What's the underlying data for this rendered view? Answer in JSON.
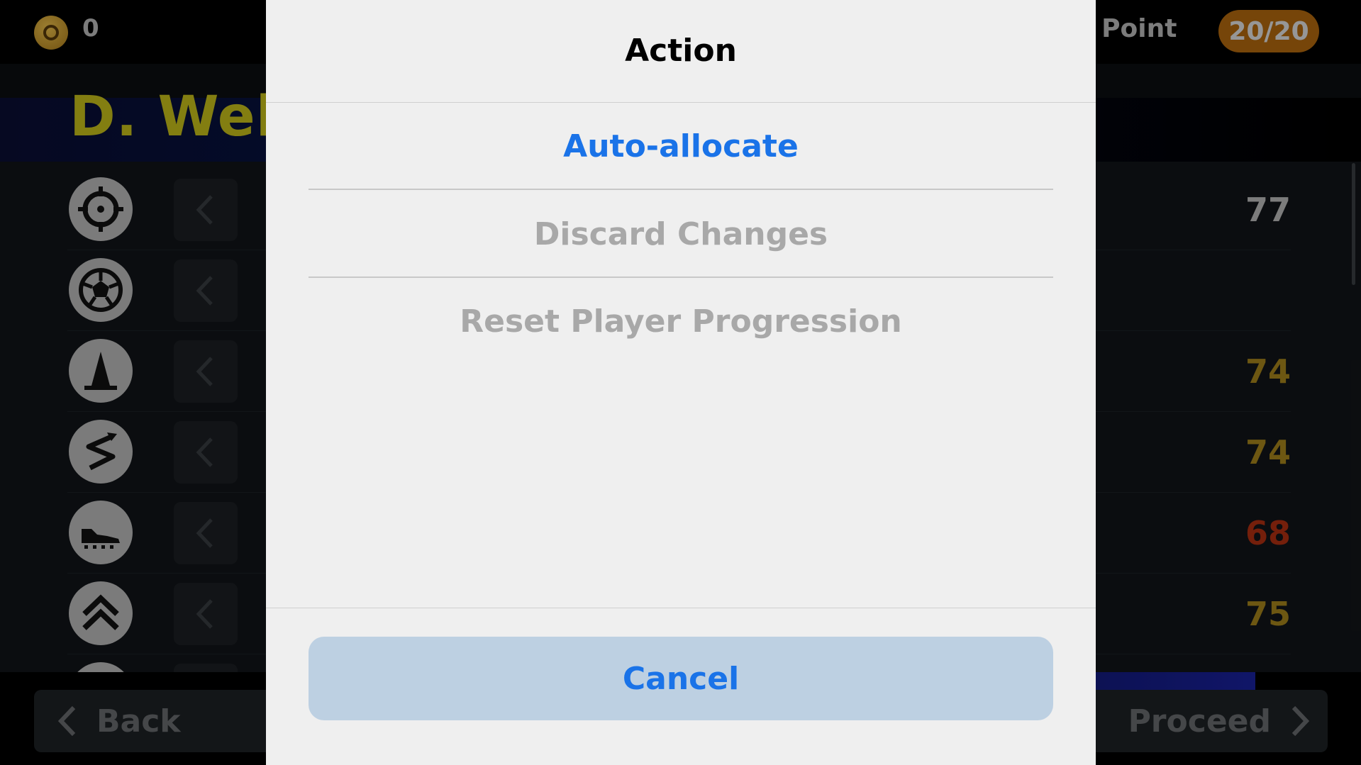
{
  "colors": {
    "accent_blue": "#1a73e8",
    "disabled_gray": "#a8a8a8",
    "cancel_bg": "#bdd0e2",
    "badge_orange": "#b56a0f",
    "name_yellow": "#c9c21b",
    "stat_white": "#bfbfbf",
    "stat_yellow": "#a8861c",
    "stat_red": "#b23112"
  },
  "header": {
    "coin_icon": "gold-coin-icon",
    "coin_count": "0",
    "points_label": "n Point",
    "points_badge": "20/20"
  },
  "player": {
    "name": "D. Welbe"
  },
  "stats": [
    {
      "icon": "crosshair-icon",
      "value": "77",
      "color": "white"
    },
    {
      "icon": "soccer-ball-icon",
      "value": "",
      "color": "white"
    },
    {
      "icon": "training-cone-icon",
      "value": "74",
      "color": "yellow"
    },
    {
      "icon": "zigzag-arrow-icon",
      "value": "74",
      "color": "yellow"
    },
    {
      "icon": "football-boot-icon",
      "value": "68",
      "color": "red"
    },
    {
      "icon": "double-chevron-up-icon",
      "value": "75",
      "color": "yellow"
    }
  ],
  "footer": {
    "back_label": "Back",
    "proceed_label": "Proceed"
  },
  "dialog": {
    "title": "Action",
    "items": [
      {
        "label": "Auto-allocate",
        "enabled": true
      },
      {
        "label": "Discard Changes",
        "enabled": false
      },
      {
        "label": "Reset Player Progression",
        "enabled": false
      }
    ],
    "cancel_label": "Cancel"
  }
}
